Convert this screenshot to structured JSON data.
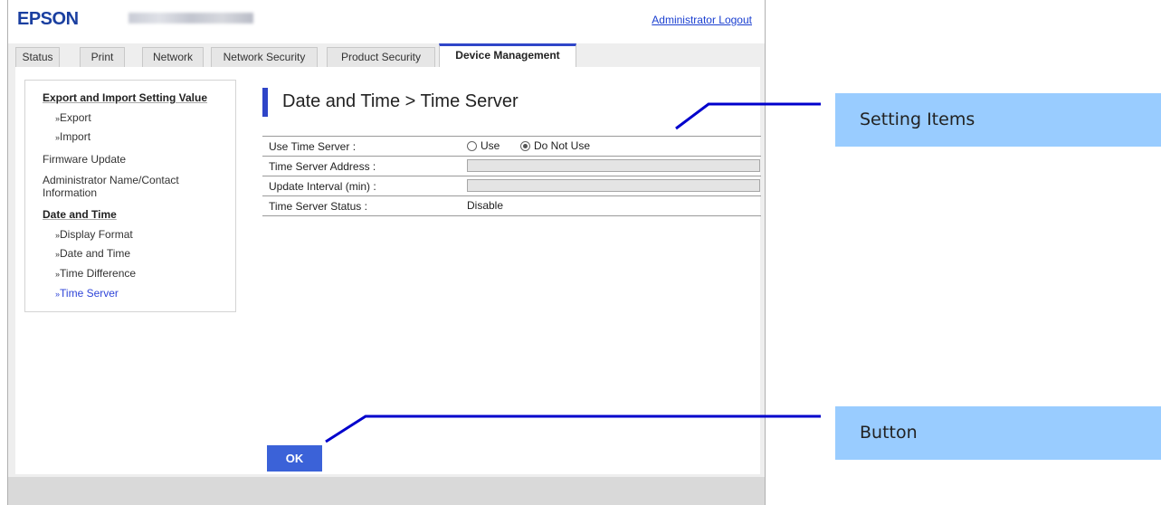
{
  "header": {
    "logo": "EPSON",
    "logout_link": "Administrator Logout"
  },
  "tabs": [
    {
      "label": "Status",
      "active": false
    },
    {
      "label": "Print",
      "active": false
    },
    {
      "label": "Network",
      "active": false
    },
    {
      "label": "Network Security",
      "active": false
    },
    {
      "label": "Product Security",
      "active": false
    },
    {
      "label": "Device Management",
      "active": true
    }
  ],
  "sidebar": {
    "section1_heading": "Export and Import Setting Value",
    "export": "Export",
    "import": "Import",
    "firmware_update": "Firmware Update",
    "admin_contact": "Administrator Name/Contact Information",
    "section2_heading": "Date and Time",
    "display_format": "Display Format",
    "date_and_time": "Date and Time",
    "time_difference": "Time Difference",
    "time_server": "Time Server",
    "chevron": "»"
  },
  "main": {
    "title": "Date and Time > Time Server",
    "rows": {
      "use_time_server": {
        "label": "Use Time Server :",
        "option_use": "Use",
        "option_do_not_use": "Do Not Use",
        "selected": "Do Not Use"
      },
      "server_address": {
        "label": "Time Server Address :",
        "value": ""
      },
      "update_interval": {
        "label": "Update Interval (min) :",
        "value": ""
      },
      "server_status": {
        "label": "Time Server Status :",
        "value": "Disable"
      }
    },
    "ok_button": "OK"
  },
  "annotations": {
    "setting_items": "Setting Items",
    "button": "Button"
  },
  "colors": {
    "accent": "#2f45c8",
    "button": "#3b62d8",
    "callout_bg": "#99ccff",
    "leader_line": "#0000cc",
    "link": "#1a3fd0"
  }
}
